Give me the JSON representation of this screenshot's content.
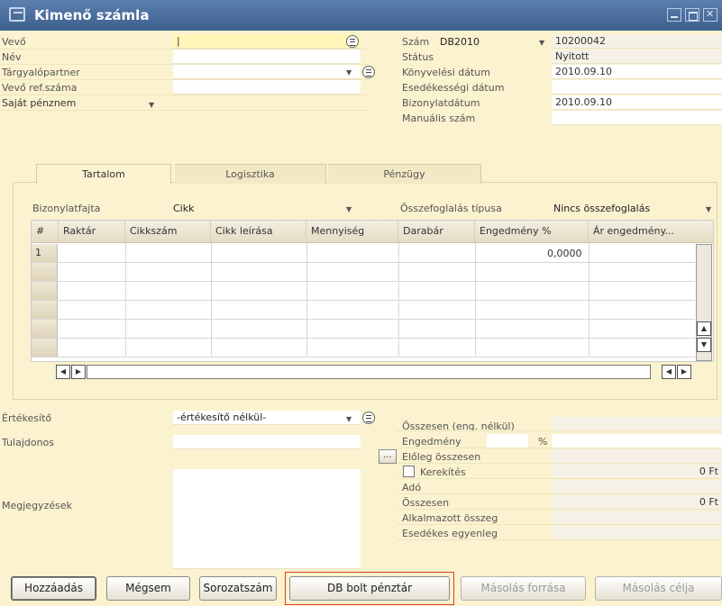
{
  "window": {
    "title": "Kimenő számla"
  },
  "header_left": {
    "vevo_label": "Vevő",
    "nev_label": "Név",
    "targyalopartner_label": "Tárgyalópartner",
    "vevo_ref_label": "Vevő ref.száma",
    "currency_label": "Saját pénznem"
  },
  "header_right": {
    "szam_label": "Szám",
    "series_value": "DB2010",
    "number_value": "10200042",
    "status_label": "Státus",
    "status_value": "Nyitott",
    "posting_date_label": "Könyvelési dátum",
    "posting_date_value": "2010.09.10",
    "due_date_label": "Esedékességi dátum",
    "document_date_label": "Bizonylatdátum",
    "document_date_value": "2010.09.10",
    "manual_number_label": "Manuális szám"
  },
  "tabs": [
    {
      "label": "Tartalom"
    },
    {
      "label": "Logisztika"
    },
    {
      "label": "Pénzügy"
    }
  ],
  "content": {
    "doc_type_label": "Bizonylatfajta",
    "doc_type_value": "Cikk",
    "summary_type_label": "Összefoglalás típusa",
    "summary_type_value": "Nincs összefoglalás"
  },
  "grid": {
    "columns": [
      "#",
      "Raktár",
      "Cikkszám",
      "Cikk leírása",
      "Mennyiség",
      "Darabár",
      "Engedmény %",
      "Ár engedmény..."
    ],
    "rows": [
      {
        "num": "1",
        "discount": "0,0000"
      }
    ]
  },
  "footer_left": {
    "sales_employee_label": "Értékesítő",
    "sales_employee_value": "-értékesítő nélkül-",
    "owner_label": "Tulajdonos",
    "remarks_label": "Megjegyzések"
  },
  "totals": {
    "before_discount_label": "Összesen (eng. nélkül)",
    "discount_label": "Engedmény",
    "percent_sign": "%",
    "down_payment_label": "Előleg összesen",
    "ellipsis_label": "...",
    "rounding_label": "Kerekítés",
    "rounding_value": "0 Ft",
    "tax_label": "Adó",
    "total_label": "Összesen",
    "total_value": "0 Ft",
    "applied_amount_label": "Alkalmazott összeg",
    "balance_due_label": "Esedékes egyenleg"
  },
  "buttons": {
    "add": "Hozzáadás",
    "cancel": "Mégsem",
    "serial": "Sorozatszám",
    "pos": "DB bolt pénztár",
    "copy_from": "Másolás forrása",
    "copy_to": "Másolás célja"
  }
}
